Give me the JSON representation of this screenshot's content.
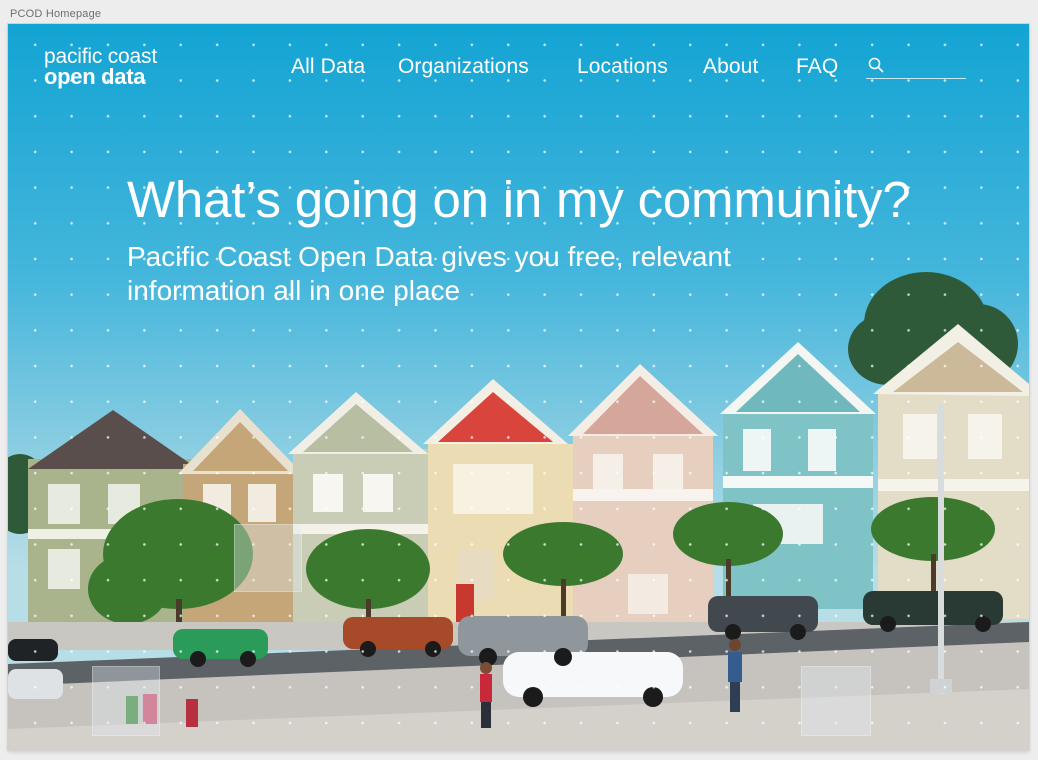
{
  "window": {
    "title": "PCOD Homepage"
  },
  "logo": {
    "line1": "pacific coast",
    "line2": "open data"
  },
  "nav": {
    "items": [
      {
        "label": "All Data"
      },
      {
        "label": "Organizations"
      },
      {
        "label": "Locations"
      },
      {
        "label": "About"
      },
      {
        "label": "FAQ"
      }
    ]
  },
  "search": {
    "icon": "search-icon",
    "placeholder": "",
    "value": ""
  },
  "hero": {
    "headline": "What’s going on in my community?",
    "subheadline": "Pacific Coast Open Data gives you free, relevant information all in one place"
  },
  "colors": {
    "sky_top": "#16a7d4",
    "sky_bottom": "#9ad2e2",
    "text": "#ffffff",
    "frame_background": "#ededed"
  }
}
